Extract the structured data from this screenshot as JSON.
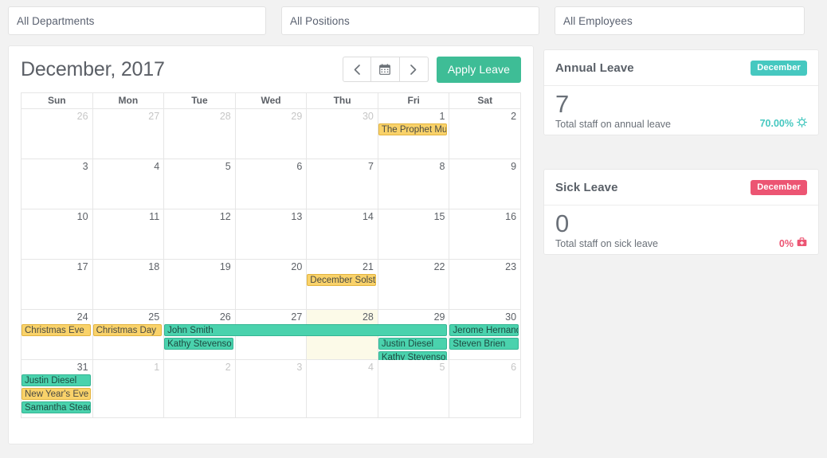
{
  "filters": [
    {
      "name": "department",
      "value": "All Departments"
    },
    {
      "name": "position",
      "value": "All Positions"
    },
    {
      "name": "employee",
      "value": "All Employees"
    }
  ],
  "calendar": {
    "title": "December, 2017",
    "nav": {
      "prev_icon": "chevron-left-icon",
      "today_icon": "calendar-icon",
      "next_icon": "chevron-right-icon"
    },
    "apply_label": "Apply Leave",
    "dow": [
      "Sun",
      "Mon",
      "Tue",
      "Wed",
      "Thu",
      "Fri",
      "Sat"
    ],
    "weeks": [
      {
        "days": [
          {
            "n": "26",
            "out": true
          },
          {
            "n": "27",
            "out": true
          },
          {
            "n": "28",
            "out": true
          },
          {
            "n": "29",
            "out": true
          },
          {
            "n": "30",
            "out": true
          },
          {
            "n": "1",
            "out": false
          },
          {
            "n": "2",
            "out": false
          }
        ],
        "events": [
          {
            "label": "The Prophet Mu",
            "type": "holiday",
            "start": 5,
            "span": 1,
            "row": 0
          }
        ]
      },
      {
        "days": [
          {
            "n": "3",
            "out": false
          },
          {
            "n": "4",
            "out": false
          },
          {
            "n": "5",
            "out": false
          },
          {
            "n": "6",
            "out": false
          },
          {
            "n": "7",
            "out": false
          },
          {
            "n": "8",
            "out": false
          },
          {
            "n": "9",
            "out": false
          }
        ],
        "events": []
      },
      {
        "days": [
          {
            "n": "10",
            "out": false
          },
          {
            "n": "11",
            "out": false
          },
          {
            "n": "12",
            "out": false
          },
          {
            "n": "13",
            "out": false
          },
          {
            "n": "14",
            "out": false
          },
          {
            "n": "15",
            "out": false
          },
          {
            "n": "16",
            "out": false
          }
        ],
        "events": []
      },
      {
        "days": [
          {
            "n": "17",
            "out": false
          },
          {
            "n": "18",
            "out": false
          },
          {
            "n": "19",
            "out": false
          },
          {
            "n": "20",
            "out": false
          },
          {
            "n": "21",
            "out": false
          },
          {
            "n": "22",
            "out": false
          },
          {
            "n": "23",
            "out": false
          }
        ],
        "events": [
          {
            "label": "December Solst",
            "type": "holiday",
            "start": 4,
            "span": 1,
            "row": 0
          }
        ]
      },
      {
        "days": [
          {
            "n": "24",
            "out": false
          },
          {
            "n": "25",
            "out": false
          },
          {
            "n": "26",
            "out": false
          },
          {
            "n": "27",
            "out": false
          },
          {
            "n": "28",
            "out": false,
            "today": true
          },
          {
            "n": "29",
            "out": false
          },
          {
            "n": "30",
            "out": false
          }
        ],
        "events": [
          {
            "label": "Christmas Eve",
            "type": "holiday",
            "start": 0,
            "span": 1,
            "row": 0
          },
          {
            "label": "Christmas Day",
            "type": "holiday",
            "start": 1,
            "span": 1,
            "row": 0
          },
          {
            "label": "John Smith",
            "type": "leave",
            "start": 2,
            "span": 4,
            "row": 0
          },
          {
            "label": "Jerome Hernand",
            "type": "leave",
            "start": 6,
            "span": 1,
            "row": 0
          },
          {
            "label": "Kathy Stevenso",
            "type": "leave",
            "start": 2,
            "span": 1,
            "row": 1
          },
          {
            "label": "Justin Diesel",
            "type": "leave",
            "start": 5,
            "span": 1,
            "row": 1
          },
          {
            "label": "Steven Brien",
            "type": "leave",
            "start": 6,
            "span": 1,
            "row": 1
          },
          {
            "label": "Kathy Stevenso",
            "type": "leave",
            "start": 5,
            "span": 1,
            "row": 2
          }
        ]
      },
      {
        "last": true,
        "days": [
          {
            "n": "31",
            "out": false
          },
          {
            "n": "1",
            "out": true
          },
          {
            "n": "2",
            "out": true
          },
          {
            "n": "3",
            "out": true
          },
          {
            "n": "4",
            "out": true
          },
          {
            "n": "5",
            "out": true
          },
          {
            "n": "6",
            "out": true
          }
        ],
        "events": [
          {
            "label": "Justin Diesel",
            "type": "leave",
            "start": 0,
            "span": 1,
            "row": 0
          },
          {
            "label": "New Year's Eve",
            "type": "holiday",
            "start": 0,
            "span": 1,
            "row": 1
          },
          {
            "label": "Samantha Stead",
            "type": "leave",
            "start": 0,
            "span": 1,
            "row": 2
          }
        ]
      }
    ]
  },
  "stats": [
    {
      "key": "annual",
      "title": "Annual Leave",
      "badge": "December",
      "badge_style": "teal",
      "number": "7",
      "subtitle": "Total staff on annual leave",
      "percent": "70.00%",
      "percent_style": "teal",
      "icon": "sun-gear-icon"
    },
    {
      "key": "sick",
      "title": "Sick Leave",
      "badge": "December",
      "badge_style": "red",
      "number": "0",
      "subtitle": "Total staff on sick leave",
      "percent": "0%",
      "percent_style": "red",
      "icon": "first-aid-kit-icon"
    }
  ],
  "colors": {
    "accent_green": "#3ebd96",
    "badge_teal": "#46c8c0",
    "badge_red": "#ec5573",
    "event_leave": "#4ad2ad",
    "event_holiday": "#f9d26a",
    "page_bg": "#f2f2f2"
  }
}
